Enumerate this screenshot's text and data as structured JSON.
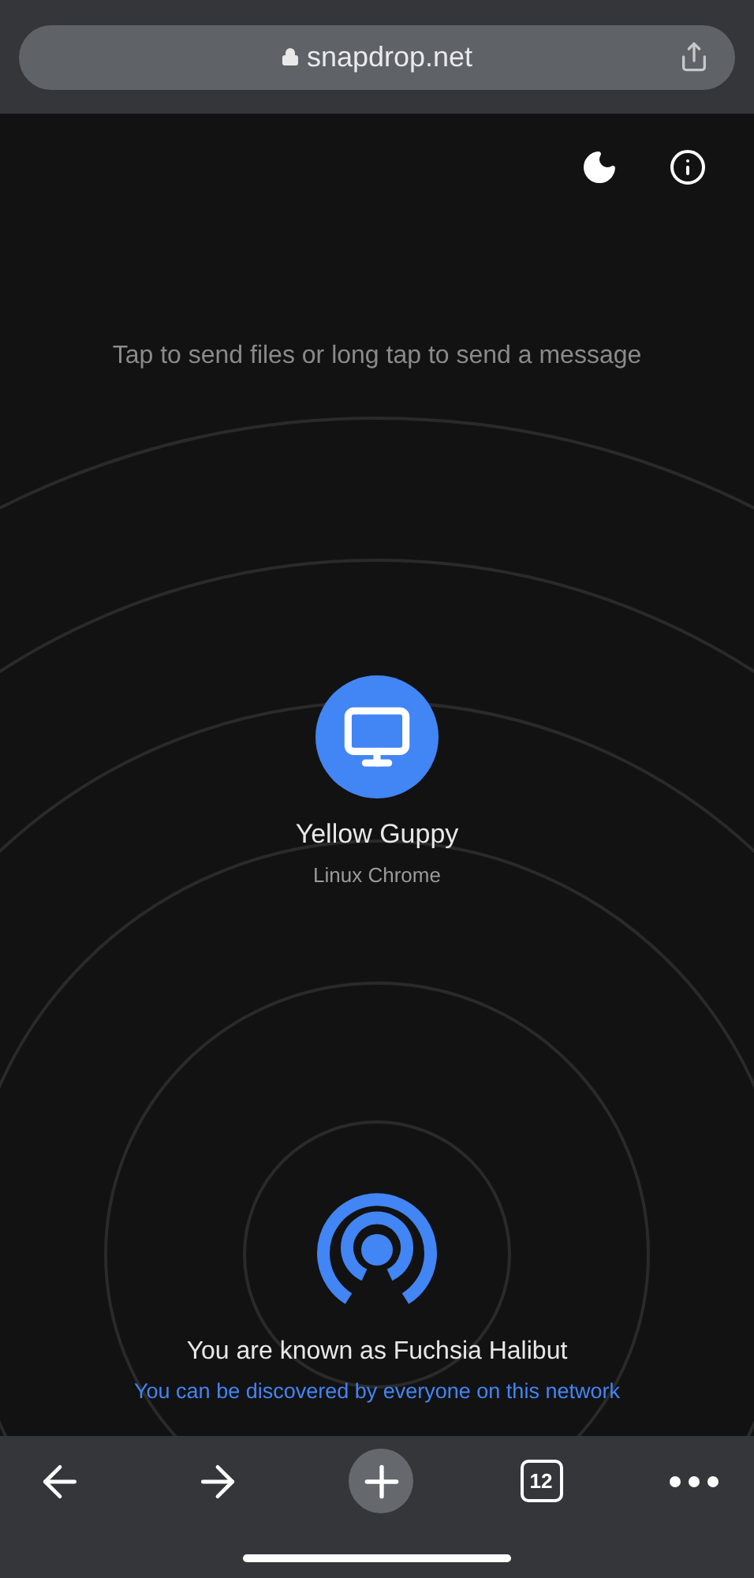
{
  "address_bar": {
    "url": "snapdrop.net"
  },
  "hint": "Tap to send files or long tap to send a message",
  "peers": [
    {
      "name": "Yellow Guppy",
      "device": "Linux Chrome",
      "kind": "desktop"
    }
  ],
  "self": {
    "name_line": "You are known as Fuchsia Halibut",
    "discovery": "You can be discovered by everyone on this network"
  },
  "toolbar": {
    "tab_count": "12"
  }
}
